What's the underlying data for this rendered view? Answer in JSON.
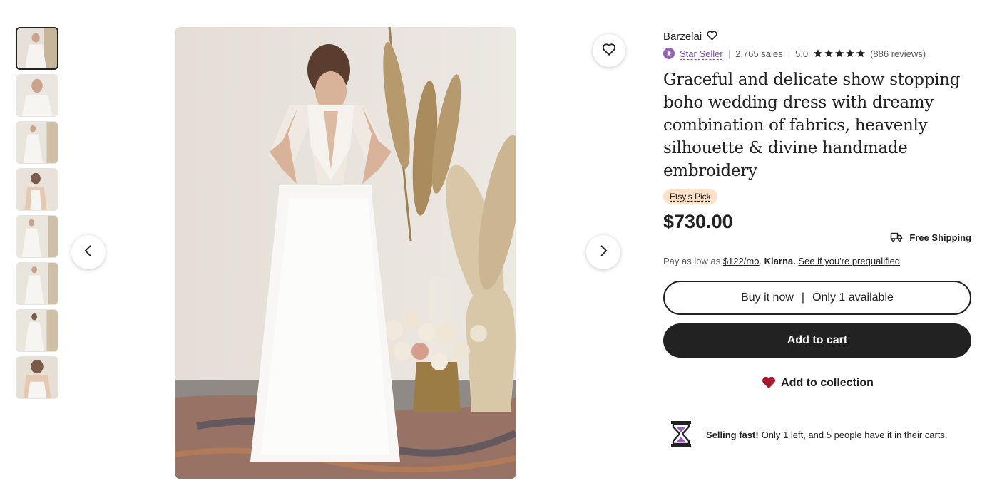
{
  "shop": {
    "name": "Barzelai"
  },
  "seller": {
    "badge": "Star Seller",
    "sales": "2,765 sales",
    "rating": "5.0",
    "reviews": "(886 reviews)",
    "stars": 5
  },
  "product": {
    "title": "Graceful and delicate show stopping boho wedding dress with dreamy combination of fabrics, heavenly silhouette & divine handmade embroidery",
    "pick_label": "Etsy's Pick",
    "price": "$730.00",
    "shipping": "Free Shipping"
  },
  "klarna": {
    "prefix": "Pay as low as",
    "amount": "$122/mo",
    "brand": "Klarna.",
    "link": "See if you're prequalified"
  },
  "actions": {
    "buy_now": "Buy it now",
    "availability": "Only 1 available",
    "add_to_cart": "Add to cart",
    "add_to_collection": "Add to collection"
  },
  "urgency": {
    "label": "Selling fast!",
    "text": "Only 1 left, and 5 people have it in their carts."
  },
  "gallery": {
    "thumbnail_count": 8,
    "active_index": 0,
    "icons": {
      "fav": "heart-icon",
      "prev": "chevron-left-icon",
      "next": "chevron-right-icon"
    }
  },
  "colors": {
    "star_seller": "#7f4bb0",
    "pick_bg": "#fde2c8",
    "heart": "#a61a2e",
    "dark": "#222222"
  }
}
